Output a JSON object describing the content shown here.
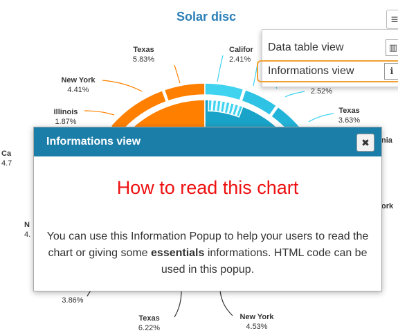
{
  "chart": {
    "title": "Solar disc",
    "colors": {
      "orange": "#ff8000",
      "blue": "#1aa3c8",
      "light_blue": "#3fd3f0",
      "title": "#2b7fb8"
    },
    "labels": [
      {
        "name": "Texas",
        "pct": "5.83%"
      },
      {
        "name": "New York",
        "pct": "4.41%"
      },
      {
        "name": "Illinois",
        "pct": "1.87%"
      },
      {
        "name": "Ca",
        "pct": "4.7"
      },
      {
        "name": "N",
        "pct": "4."
      },
      {
        "name": "",
        "pct": "3.86%"
      },
      {
        "name": "Texas",
        "pct": "6.22%"
      },
      {
        "name": "New York",
        "pct": "4.53%"
      },
      {
        "name": "Califor",
        "pct": "2.41%"
      },
      {
        "name": "",
        "pct": "2.52%"
      },
      {
        "name": "Texas",
        "pct": "3.63%"
      },
      {
        "name": "nia",
        "pct": ""
      },
      {
        "name": "ork",
        "pct": ""
      }
    ]
  },
  "menu": {
    "button_icon": "hamburger-menu-icon",
    "items": [
      {
        "label": "Data table view",
        "icon": "table-icon"
      },
      {
        "label": "Informations view",
        "icon": "info-person-icon"
      }
    ]
  },
  "modal": {
    "header": "Informations view",
    "close_icon": "close-icon",
    "heading": "How to read this chart",
    "text_before": "You can use this Information Popup to help your users to read the chart or giving some ",
    "text_bold": "essentials",
    "text_after": " informations. HTML code can be used in this popup."
  }
}
